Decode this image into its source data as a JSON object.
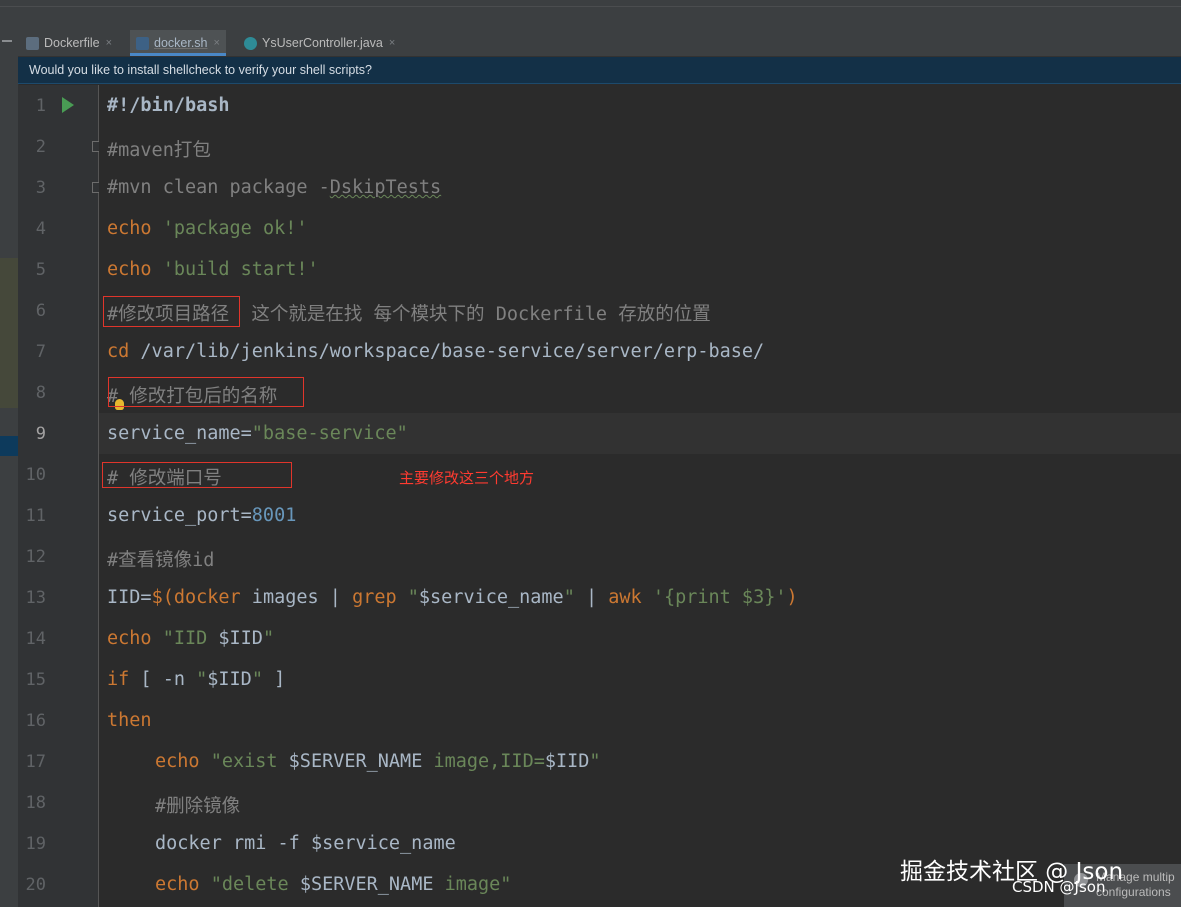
{
  "tabs": [
    {
      "label": "Dockerfile",
      "icon": "docker-file-icon",
      "active": false
    },
    {
      "label": "docker.sh",
      "icon": "shell-script-icon",
      "active": true
    },
    {
      "label": "YsUserController.java",
      "icon": "java-class-icon",
      "active": false
    }
  ],
  "tab_close": "×",
  "banner": {
    "text": "Would you like to install shellcheck to verify your shell scripts?"
  },
  "line_numbers": [
    "1",
    "2",
    "3",
    "4",
    "5",
    "6",
    "7",
    "8",
    "9",
    "10",
    "11",
    "12",
    "13",
    "14",
    "15",
    "16",
    "17",
    "18",
    "19",
    "20"
  ],
  "code": {
    "l1": "#!/bin/bash",
    "l2": "#maven打包",
    "l3a": "#mvn clean package -",
    "l3b": "DskipTests",
    "l4_kw": "echo",
    "l4_str": "'package ok!'",
    "l5_kw": "echo",
    "l5_str": "'build start!'",
    "l6": "#修改项目路径  这个就是在找 每个模块下的 Dockerfile 存放的位置",
    "l7_kw": "cd",
    "l7_rest": " /var/lib/jenkins/workspace/base-service/server/erp-base/",
    "l8": "# 修改打包后的名称",
    "l9_a": "service_name=",
    "l9_str": "\"base-service\"",
    "l10": "# 修改端口号",
    "l11_a": "service_port=",
    "l11_num": "8001",
    "l12": "#查看镜像id",
    "l13_a": "IID=",
    "l13_b": "$(",
    "l13_c": "docker",
    "l13_d": " images | ",
    "l13_e": "grep",
    "l13_f": " \"",
    "l13_g": "$service_name",
    "l13_h": "\"",
    "l13_i": " | ",
    "l13_j": "awk",
    "l13_k": " '{print $3}'",
    "l13_l": ")",
    "l14_kw": "echo",
    "l14_s1": " \"IID ",
    "l14_var": "$IID",
    "l14_s2": "\"",
    "l15_kw": "if",
    "l15_a": " [ -n ",
    "l15_s1": "\"",
    "l15_var": "$IID",
    "l15_s2": "\"",
    "l15_b": " ]",
    "l16_kw": "then",
    "l17_kw": "echo",
    "l17_s1": " \"exist ",
    "l17_var1": "$SERVER_NAME",
    "l17_s2": " image,IID=",
    "l17_var2": "$IID",
    "l17_s3": "\"",
    "l18": "#删除镜像",
    "l19_a": "docker rmi -f ",
    "l19_var": "$service_name",
    "l20_kw": "echo",
    "l20_s1": " \"delete ",
    "l20_var": "$SERVER_NAME",
    "l20_s2": " image\""
  },
  "annotation": "主要修改这三个地方",
  "watermark": {
    "primary": "掘金技术社区 @ Json",
    "secondary": "CSDN @Json"
  },
  "popup": {
    "line1": "Manage multip",
    "line2": "configurations"
  },
  "colors": {
    "keyword": "#cc7832",
    "string": "#6a8759",
    "comment": "#808080",
    "number": "#6897bb",
    "highlight_box": "#e0352b"
  }
}
